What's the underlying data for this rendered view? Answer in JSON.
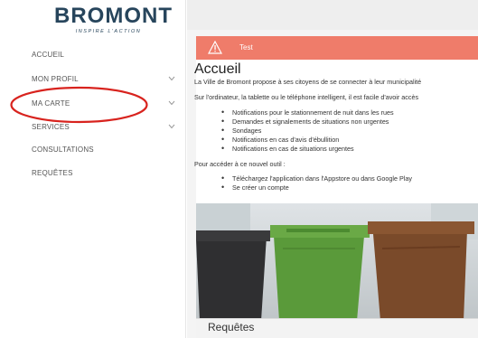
{
  "logo": {
    "name": "BROMONT",
    "tagline": "INSPIRE L'ACTION"
  },
  "sidebar": {
    "items": [
      {
        "label": "ACCUEIL",
        "has_chevron": false
      },
      {
        "label": "MON PROFIL",
        "has_chevron": true
      },
      {
        "label": "MA CARTE",
        "has_chevron": true
      },
      {
        "label": "SERVICES",
        "has_chevron": true
      },
      {
        "label": "CONSULTATIONS",
        "has_chevron": false
      },
      {
        "label": "REQUÊTES",
        "has_chevron": false
      }
    ]
  },
  "alert": {
    "text": "Test",
    "color": "#ef7c6a",
    "icon": "warning-icon"
  },
  "main": {
    "title": "Accueil",
    "intro": "La Ville de Bromont propose à ses citoyens de se connecter à leur municipalité",
    "devices_line": "Sur l'ordinateur, la tablette ou le téléphone intelligent, il est facile d'avoir accès",
    "features": [
      "Notifications pour le stationnement de nuit dans les rues",
      "Demandes et signalements de situations non urgentes",
      "Sondages",
      "Notifications en cas d'avis d'ébullition",
      "Notifications en cas de situations urgentes"
    ],
    "access_line": "Pour accéder à ce nouvel outil :",
    "steps": [
      "Téléchargez l'application dans l'Appstore ou dans Google Play",
      "Se créer un compte"
    ],
    "section_title": "Requêtes"
  },
  "colors": {
    "brand": "#27455c",
    "alert": "#ef7c6a",
    "annotation": "#d8231e"
  }
}
